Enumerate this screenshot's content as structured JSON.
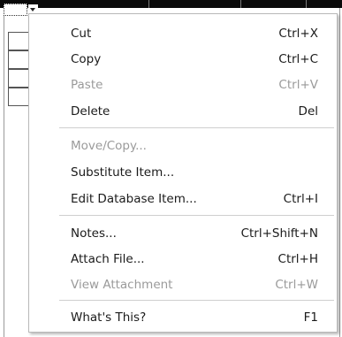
{
  "context_menu": {
    "items": [
      {
        "label": "Cut",
        "shortcut": "Ctrl+X",
        "enabled": true
      },
      {
        "label": "Copy",
        "shortcut": "Ctrl+C",
        "enabled": true
      },
      {
        "label": "Paste",
        "shortcut": "Ctrl+V",
        "enabled": false
      },
      {
        "label": "Delete",
        "shortcut": "Del",
        "enabled": true
      },
      {
        "label": "Move/Copy...",
        "shortcut": "",
        "enabled": false
      },
      {
        "label": "Substitute Item...",
        "shortcut": "",
        "enabled": true
      },
      {
        "label": "Edit Database Item...",
        "shortcut": "Ctrl+I",
        "enabled": true
      },
      {
        "label": "Notes...",
        "shortcut": "Ctrl+Shift+N",
        "enabled": true
      },
      {
        "label": "Attach File...",
        "shortcut": "Ctrl+H",
        "enabled": true
      },
      {
        "label": "View Attachment",
        "shortcut": "Ctrl+W",
        "enabled": false
      },
      {
        "label": "What's This?",
        "shortcut": "F1",
        "enabled": true
      }
    ]
  },
  "icons": {
    "dropdown": "chevron-down-icon"
  },
  "colors": {
    "menu_background": "#ffffff",
    "text_enabled": "#1a1a1a",
    "text_disabled": "#9a9a9a",
    "separator": "#cfcfcf"
  }
}
